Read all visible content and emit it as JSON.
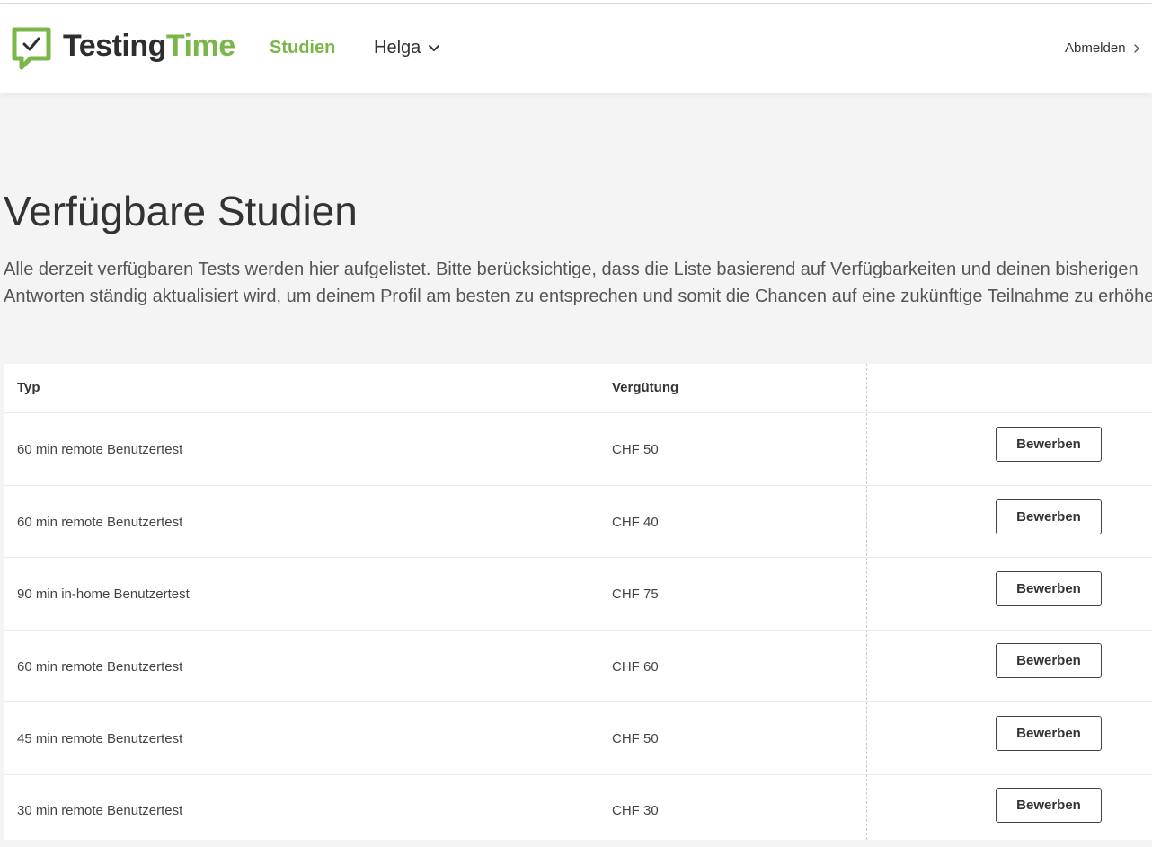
{
  "header": {
    "brand_part1": "Testing",
    "brand_part2": "Time",
    "nav_studien": "Studien",
    "user_name": "Helga",
    "logout_label": "Abmelden",
    "accent_color": "#7ab648"
  },
  "main": {
    "title": "Verfügbare Studien",
    "description": "Alle derzeit verfügbaren Tests werden hier aufgelistet. Bitte berücksichtige, dass die Liste basierend auf Verfügbarkeiten und deinen bisherigen Antworten ständig aktualisiert wird, um deinem Profil am besten zu entsprechen und somit die Chancen auf eine zukünftige Teilnahme zu erhöhen."
  },
  "table": {
    "columns": [
      "Typ",
      "Vergütung",
      ""
    ],
    "rows": [
      {
        "type": "60 min remote Benutzertest",
        "reward": "CHF 50",
        "action": "Bewerben"
      },
      {
        "type": "60 min remote Benutzertest",
        "reward": "CHF 40",
        "action": "Bewerben"
      },
      {
        "type": "90 min in-home Benutzertest",
        "reward": "CHF 75",
        "action": "Bewerben"
      },
      {
        "type": "60 min remote Benutzertest",
        "reward": "CHF 60",
        "action": "Bewerben"
      },
      {
        "type": "45 min remote Benutzertest",
        "reward": "CHF 50",
        "action": "Bewerben"
      },
      {
        "type": "30 min remote Benutzertest",
        "reward": "CHF 30",
        "action": "Bewerben"
      }
    ]
  }
}
